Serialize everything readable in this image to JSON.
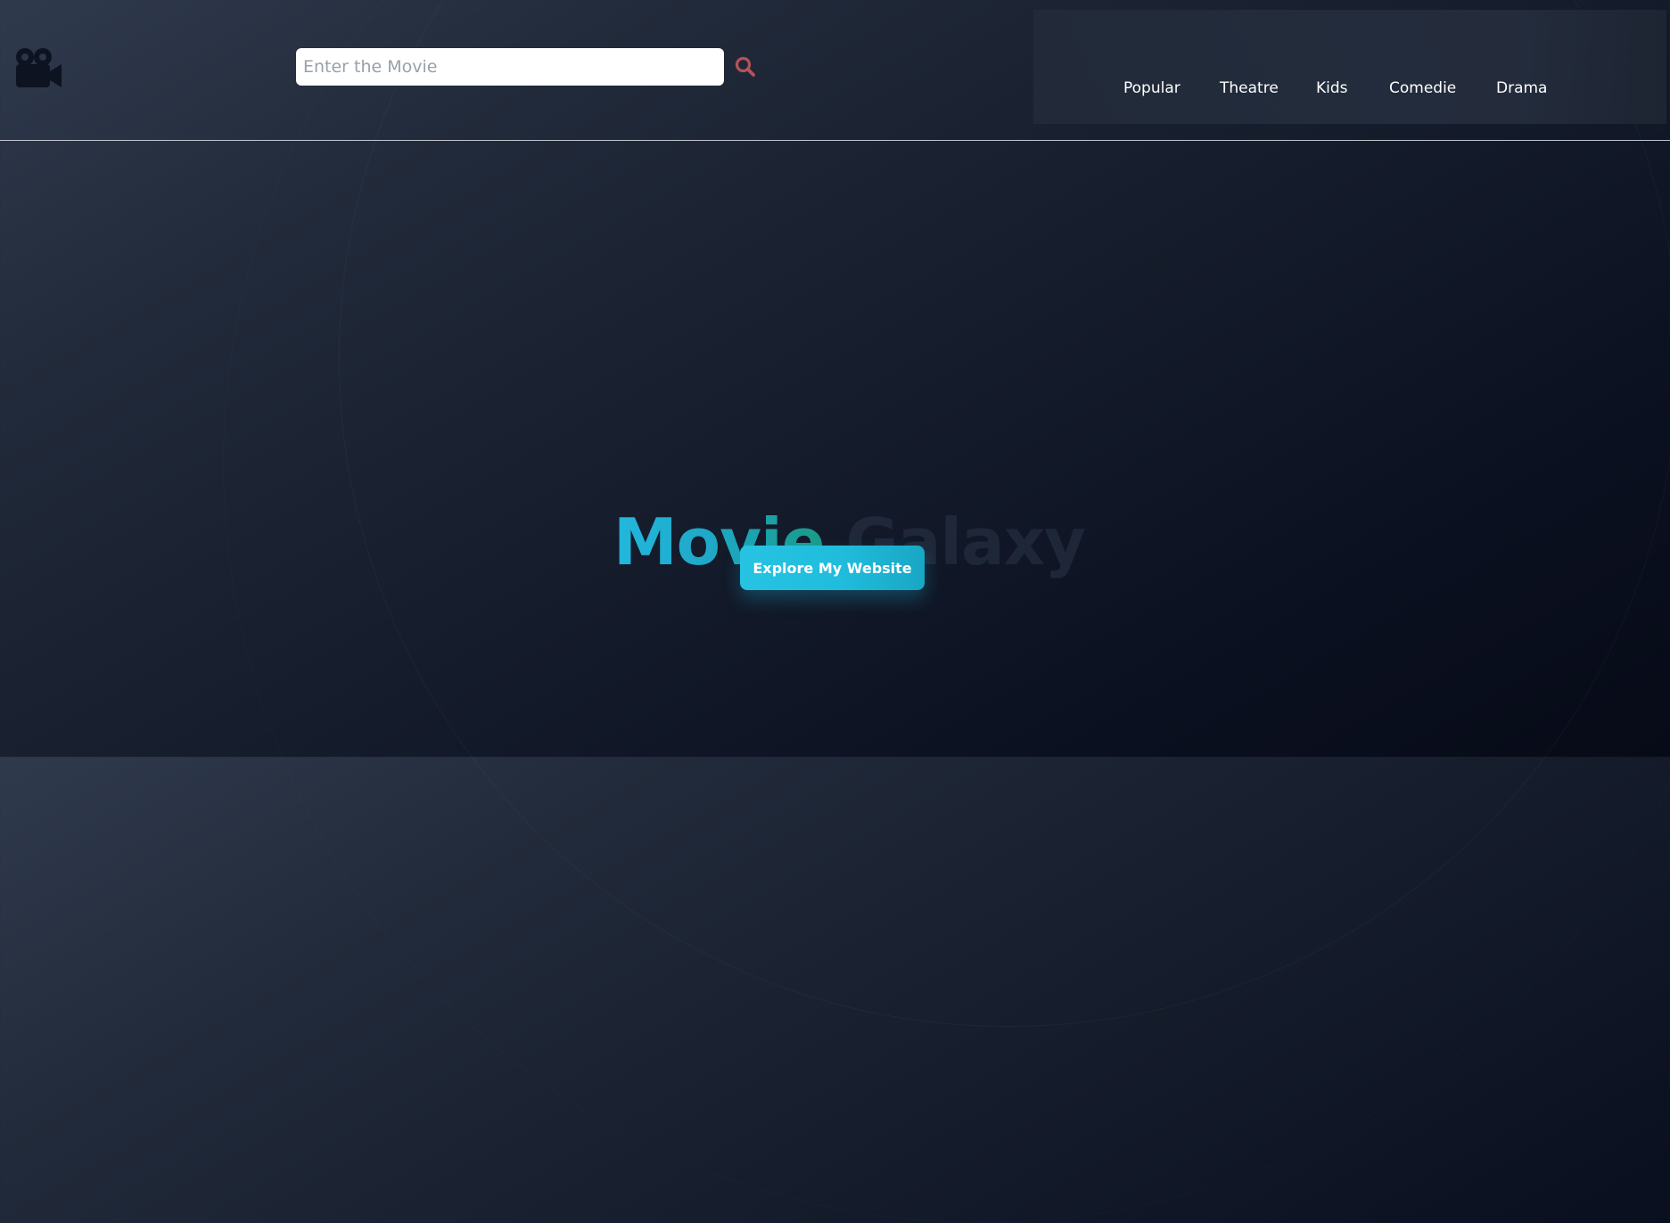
{
  "header": {
    "logo_icon": "movie-camera-icon",
    "search": {
      "placeholder": "Enter the Movie",
      "value": "",
      "button_icon": "magnifier-search-icon",
      "button_color": "#b5525a"
    },
    "nav": {
      "items": [
        {
          "label": "Popular"
        },
        {
          "label": "Theatre"
        },
        {
          "label": "Kids"
        },
        {
          "label": "Comedie"
        },
        {
          "label": "Drama"
        }
      ]
    }
  },
  "hero": {
    "title_word_1": "Movie",
    "title_word_2": "Galaxy",
    "cta_label": "Explore My Website"
  },
  "colors": {
    "accent": "#22b8dd",
    "accent_teal": "#1a9a86",
    "background_dark": "#0b1020",
    "nav_text": "#ffffff"
  }
}
